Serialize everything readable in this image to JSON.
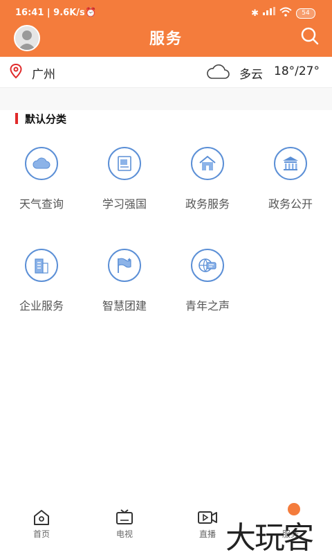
{
  "status": {
    "time": "16:41 | 9.6K/s",
    "alarm_icon": "alarm-icon",
    "battery": "54"
  },
  "header": {
    "title": "服务"
  },
  "location": {
    "city": "广州",
    "weather": "多云",
    "temperature": "18°/27°"
  },
  "section": {
    "title": "默认分类"
  },
  "services": [
    {
      "label": "天气查询",
      "icon": "cloud-icon"
    },
    {
      "label": "学习强国",
      "icon": "study-icon"
    },
    {
      "label": "政务服务",
      "icon": "house-icon"
    },
    {
      "label": "政务公开",
      "icon": "government-building-icon"
    },
    {
      "label": "企业服务",
      "icon": "enterprise-icon"
    },
    {
      "label": "智慧团建",
      "icon": "flag-icon"
    },
    {
      "label": "青年之声",
      "icon": "globe-chat-icon"
    }
  ],
  "tabs": [
    {
      "label": "首页",
      "icon": "home-icon"
    },
    {
      "label": "电视",
      "icon": "tv-icon"
    },
    {
      "label": "直播",
      "icon": "live-video-icon"
    },
    {
      "label": "服务",
      "icon": "service-icon"
    }
  ],
  "watermark": "大玩客",
  "colors": {
    "brand": "#f47c3c",
    "icon_blue": "#5b8fd6",
    "accent_red": "#e02a2a"
  }
}
